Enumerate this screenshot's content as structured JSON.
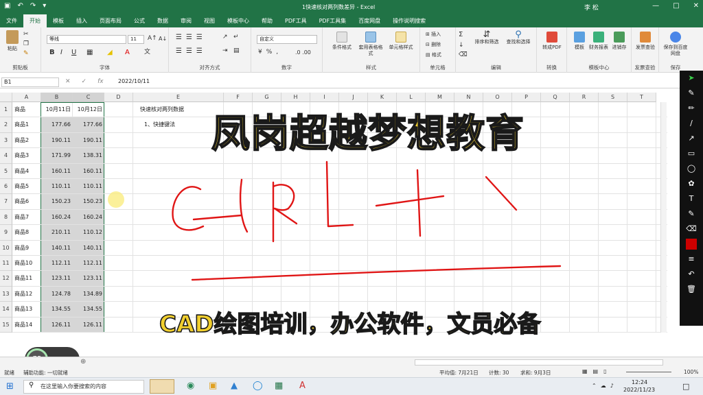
{
  "window": {
    "title": "1快速核对两列数差异 - Excel",
    "user": "李 松"
  },
  "tabs": [
    "文件",
    "开始",
    "模板",
    "插入",
    "页面布局",
    "公式",
    "数据",
    "审阅",
    "视图",
    "模板中心",
    "帮助",
    "PDF工具",
    "PDF工具集",
    "百度网盘",
    "操作说明搜索"
  ],
  "ribbon": {
    "paste": "粘贴",
    "clipboard": "剪贴板",
    "font_name": "等线",
    "font_size": "11",
    "font_group": "字体",
    "align_group": "对齐方式",
    "number_format": "自定义",
    "number_group": "数字",
    "cond_format": "条件格式",
    "table_format": "套用表格格式",
    "cell_style": "单元格样式",
    "style_group": "样式",
    "insert": "插入",
    "delete": "删除",
    "format": "格式",
    "cells_group": "单元格",
    "sort_filter": "排序和筛选",
    "find_select": "查找和选择",
    "edit_group": "编辑",
    "to_pdf": "转成PDF",
    "convert_group": "转换",
    "template": "模板",
    "finance": "财务报表",
    "invoicing": "进销存",
    "template_group": "模板中心",
    "invoice": "发票查验",
    "invoice_group": "发票查验",
    "save_baidu": "保存到百度网盘",
    "save_group": "保存"
  },
  "formula_bar": {
    "cell": "B1",
    "value": "2022/10/11"
  },
  "columns": [
    "A",
    "B",
    "C",
    "D",
    "E",
    "F",
    "G",
    "H",
    "I",
    "J",
    "K",
    "L",
    "M",
    "N",
    "O",
    "P",
    "Q",
    "R",
    "S",
    "T"
  ],
  "rows": [
    "1",
    "2",
    "3",
    "4",
    "5",
    "6",
    "7",
    "8",
    "9",
    "10",
    "11",
    "12",
    "13",
    "14",
    "15",
    "16"
  ],
  "sheet": {
    "headers": {
      "a": "商品",
      "b": "10月11日",
      "c": "10月12日"
    },
    "items": [
      {
        "name": "商品1",
        "b": "177.66",
        "c": "177.66"
      },
      {
        "name": "商品2",
        "b": "190.11",
        "c": "190.11"
      },
      {
        "name": "商品3",
        "b": "171.99",
        "c": "138.31"
      },
      {
        "name": "商品4",
        "b": "160.11",
        "c": "160.11"
      },
      {
        "name": "商品5",
        "b": "110.11",
        "c": "110.11"
      },
      {
        "name": "商品6",
        "b": "150.23",
        "c": "150.23"
      },
      {
        "name": "商品7",
        "b": "160.24",
        "c": "160.24"
      },
      {
        "name": "商品8",
        "b": "210.11",
        "c": "110.12"
      },
      {
        "name": "商品9",
        "b": "140.11",
        "c": "140.11"
      },
      {
        "name": "商品10",
        "b": "112.11",
        "c": "112.11"
      },
      {
        "name": "商品11",
        "b": "123.11",
        "c": "123.11"
      },
      {
        "name": "商品12",
        "b": "124.78",
        "c": "134.89"
      },
      {
        "name": "商品13",
        "b": "134.55",
        "c": "134.55"
      },
      {
        "name": "商品14",
        "b": "126.11",
        "c": "126.11"
      }
    ],
    "note_title": "快速核对两列数据",
    "note_item": "1、快捷键法"
  },
  "overlay": {
    "title": "凤岗超越梦想教育",
    "subtitle": "CAD绘图培训，办公软件，文员必备"
  },
  "status": {
    "ready": "就绪",
    "accessibility": "辅助功能: 一切就绪",
    "average": "平均值: 7月21日",
    "count": "计数: 30",
    "sum": "求和: 9月3日",
    "zoom": "100%",
    "gauge": "75"
  },
  "taskbar": {
    "search_placeholder": "在这里输入你要搜索的内容",
    "time": "12:24",
    "date": "2022/11/23"
  },
  "colors": {
    "excel_green": "#217346",
    "overlay_yellow": "#f1cf2e",
    "ink_red": "#e01515"
  }
}
